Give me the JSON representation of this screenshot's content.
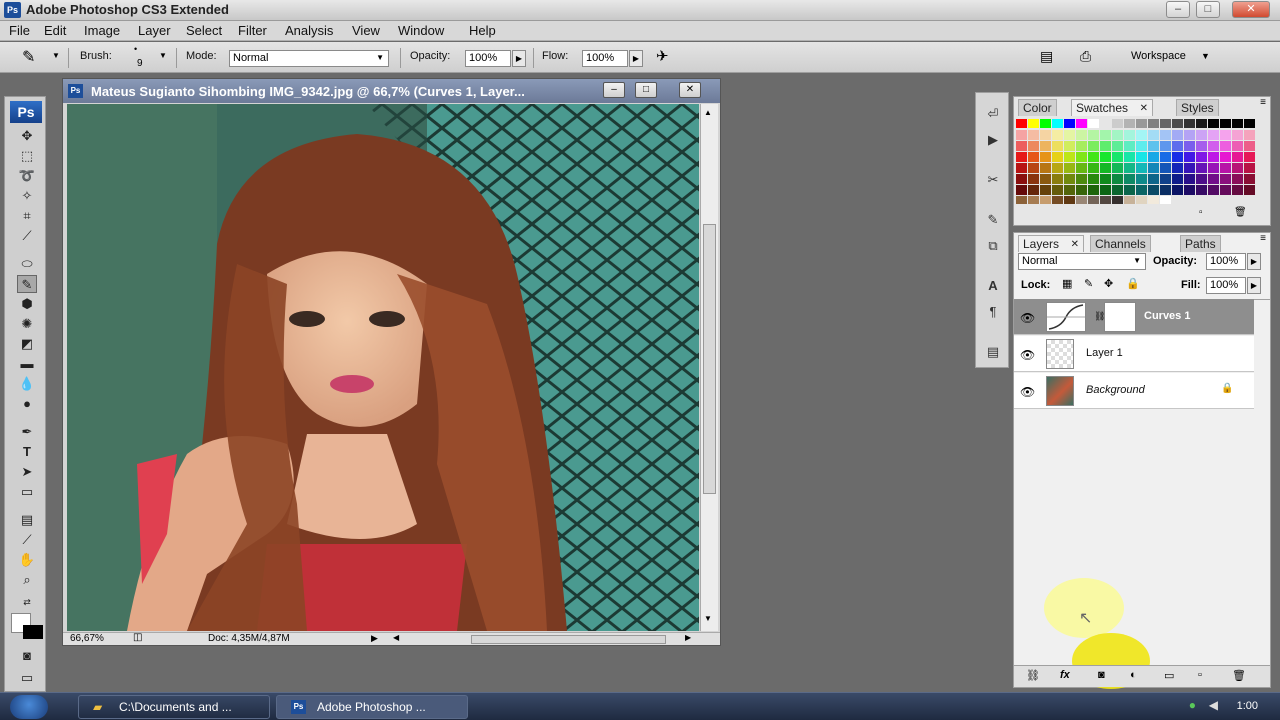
{
  "app": {
    "title": "Adobe Photoshop CS3 Extended",
    "logo": "Ps"
  },
  "menu": [
    "File",
    "Edit",
    "Image",
    "Layer",
    "Select",
    "Filter",
    "Analysis",
    "View",
    "Window",
    "Help"
  ],
  "options": {
    "brush_label": "Brush:",
    "brush_size": "9",
    "mode_label": "Mode:",
    "mode_value": "Normal",
    "opacity_label": "Opacity:",
    "opacity_value": "100%",
    "flow_label": "Flow:",
    "flow_value": "100%",
    "workspace_label": "Workspace"
  },
  "document": {
    "title": "Mateus Sugianto Sihombing IMG_9342.jpg @ 66,7% (Curves 1, Layer...",
    "zoom": "66,67%",
    "doc_size": "Doc: 4,35M/4,87M"
  },
  "color_panel": {
    "tabs": [
      "Color",
      "Swatches",
      "Styles"
    ]
  },
  "layers_panel": {
    "tabs": [
      "Layers",
      "Channels",
      "Paths"
    ],
    "blend_mode": "Normal",
    "opacity_label": "Opacity:",
    "opacity_value": "100%",
    "lock_label": "Lock:",
    "fill_label": "Fill:",
    "fill_value": "100%",
    "layers": [
      {
        "name": "Curves 1",
        "selected": true
      },
      {
        "name": "Layer 1",
        "selected": false
      },
      {
        "name": "Background",
        "selected": false
      }
    ]
  },
  "taskbar": {
    "items": [
      "C:\\Documents and ...",
      "Adobe Photoshop ..."
    ],
    "clock": "1:00"
  },
  "colors": {
    "accent": "#1d4e9a",
    "selected_layer": "#8e8e8e"
  }
}
